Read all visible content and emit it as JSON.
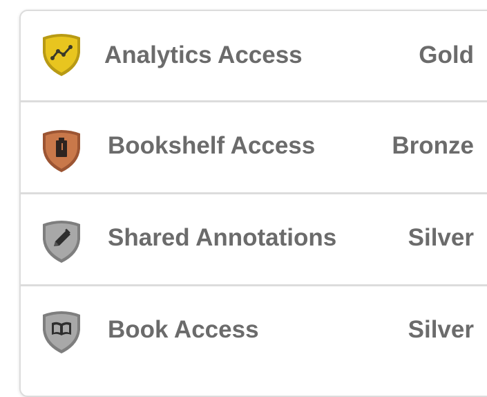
{
  "colors": {
    "gold": "#e8c51f",
    "gold_dark": "#b89a14",
    "bronze": "#c9784a",
    "bronze_dark": "#9c5533",
    "silver": "#a8a8a8",
    "silver_dark": "#7e7e7e",
    "text": "#6b6b6b"
  },
  "items": [
    {
      "label": "Analytics Access",
      "tier": "Gold",
      "icon": "chart-line-icon"
    },
    {
      "label": "Bookshelf Access",
      "tier": "Bronze",
      "icon": "book-stand-icon"
    },
    {
      "label": "Shared Annotations",
      "tier": "Silver",
      "icon": "pencil-icon"
    },
    {
      "label": "Book Access",
      "tier": "Silver",
      "icon": "open-book-icon"
    }
  ]
}
